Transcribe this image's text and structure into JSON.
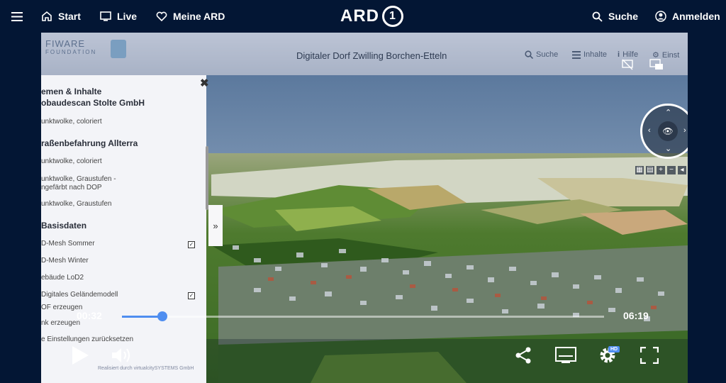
{
  "nav": {
    "start": "Start",
    "live": "Live",
    "meine_ard": "Meine ARD",
    "logo": "ARD",
    "logo_mark": "1",
    "search": "Suche",
    "login": "Anmelden"
  },
  "webapp": {
    "title": "Digitaler Dorf Zwilling Borchen-Etteln",
    "logo_line1": "FIWARE",
    "logo_line2": "FOUNDATION",
    "nav": [
      "Suche",
      "Inhalte",
      "Hilfe",
      "Einst"
    ]
  },
  "panel": {
    "heading_themes": "emen & Inhalte",
    "heading_stolte": "obaudescan Stolte GmbH",
    "stolte_items": [
      "unktwolke, coloriert"
    ],
    "heading_alterra": "raßenbefahrung Allterra",
    "alterra_items": [
      "unktwolke, coloriert",
      "unktwolke, Graustufen -",
      "ngefärbt nach DOP",
      "unktwolke, Graustufen"
    ],
    "heading_basis": "Basisdaten",
    "basis_items": [
      "D-Mesh Sommer",
      "D-Mesh Winter",
      "ebäude LoD2",
      "Digitales Geländemodell",
      "OF erzeugen",
      "nk erzeugen",
      "e Einstellungen zurücksetzen"
    ],
    "footer": "Realisiert durch virtualcitySYSTEMS GmbH",
    "expand": "»"
  },
  "player": {
    "current_time": "00:32",
    "duration": "06:19",
    "progress": 0.084,
    "hd_badge": "HD",
    "accent": "#4f8ef0"
  }
}
